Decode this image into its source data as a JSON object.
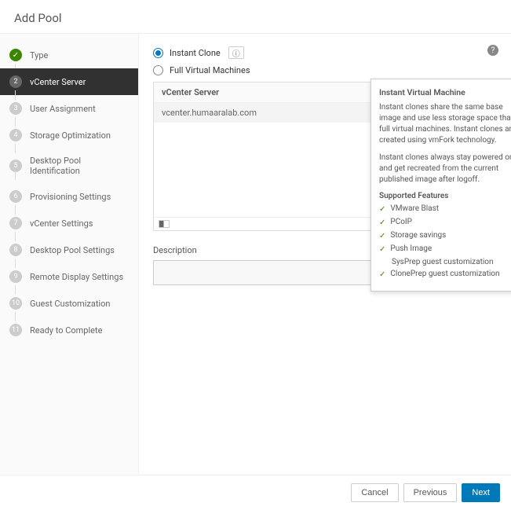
{
  "header": {
    "title": "Add Pool"
  },
  "sidebar": {
    "steps": [
      {
        "num": "✓",
        "label": "Type"
      },
      {
        "num": "2",
        "label": "vCenter Server"
      },
      {
        "num": "3",
        "label": "User Assignment"
      },
      {
        "num": "4",
        "label": "Storage Optimization"
      },
      {
        "num": "5",
        "label": "Desktop Pool Identification"
      },
      {
        "num": "6",
        "label": "Provisioning Settings"
      },
      {
        "num": "7",
        "label": "vCenter Settings"
      },
      {
        "num": "8",
        "label": "Desktop Pool Settings"
      },
      {
        "num": "9",
        "label": "Remote Display Settings"
      },
      {
        "num": "10",
        "label": "Guest Customization"
      },
      {
        "num": "11",
        "label": "Ready to Complete"
      }
    ]
  },
  "main": {
    "radios": {
      "instant_clone": "Instant Clone",
      "full_vm": "Full Virtual Machines"
    },
    "table": {
      "header": "vCenter Server",
      "row0": "vcenter.humaaralab.com"
    },
    "description_label": "Description"
  },
  "tooltip": {
    "title": "Instant Virtual Machine",
    "p1": "Instant clones share the same base image and use less storage space than full virtual machines. Instant clones are created using vmFork technology.",
    "p2": "Instant clones always stay powered on and get recreated from the current published image after logoff.",
    "features_title": "Supported Features",
    "f1": "VMware Blast",
    "f2": "PCoIP",
    "f3": "Storage savings",
    "f4": "Push Image",
    "f4sub": "SysPrep guest customization",
    "f5": "ClonePrep guest customization"
  },
  "footer": {
    "cancel": "Cancel",
    "previous": "Previous",
    "next": "Next"
  }
}
